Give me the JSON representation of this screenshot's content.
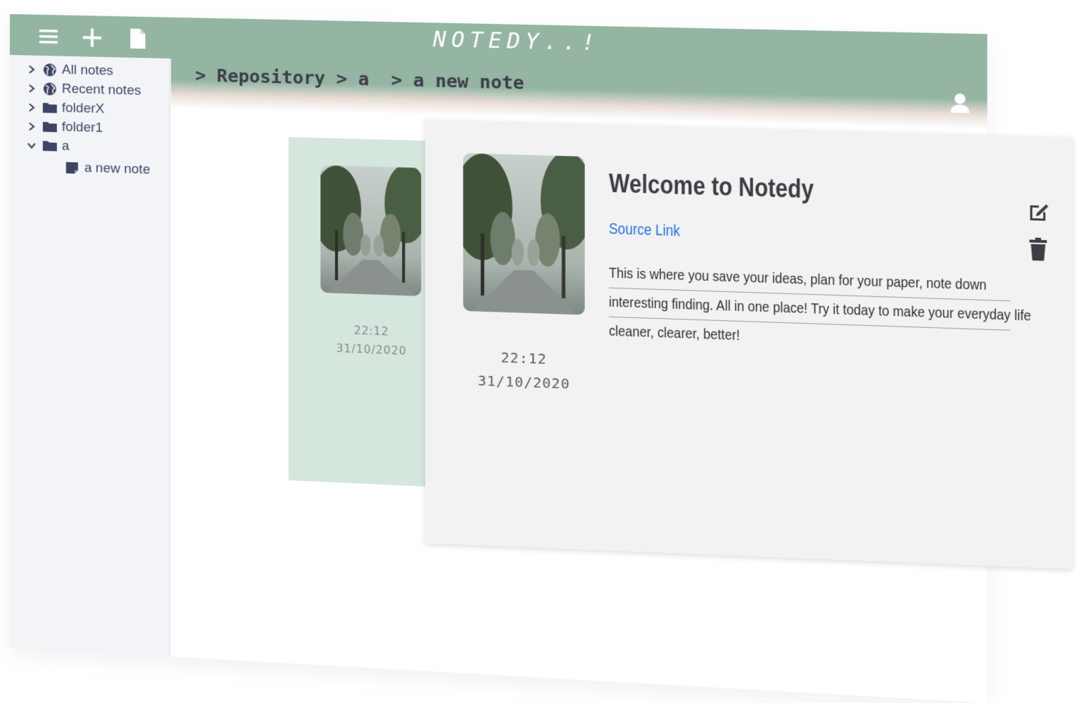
{
  "app": {
    "title": "NOTEDY..!",
    "breadcrumb": "> Repository > a  > a new note"
  },
  "toolbar": {
    "icons": [
      "menu-icon",
      "add-icon",
      "new-file-icon"
    ]
  },
  "header": {
    "user_icon": "user-icon"
  },
  "sidebar": {
    "items": [
      {
        "label": "All notes",
        "icon": "globe-icon",
        "expanded": false
      },
      {
        "label": "Recent notes",
        "icon": "globe-icon",
        "expanded": false
      },
      {
        "label": "folderX",
        "icon": "folder-icon",
        "expanded": false
      },
      {
        "label": "folder1",
        "icon": "folder-icon",
        "expanded": false
      },
      {
        "label": "a",
        "icon": "folder-icon",
        "expanded": true
      },
      {
        "label": "a new note",
        "icon": "note-icon"
      }
    ]
  },
  "background_note": {
    "time": "22:12",
    "date": "31/10/2020"
  },
  "note": {
    "title": "Welcome to Notedy",
    "source_link": "Source Link",
    "body_lines": [
      "This is where you save your ideas, plan for your paper, note down",
      "interesting finding. All in one place! Try it today to make your everyday life",
      "cleaner, clearer, better!"
    ],
    "time": "22:12",
    "date": "31/10/2020"
  },
  "colors": {
    "topbar": "#93b5a2",
    "sidebar_bg": "#f3f4f8",
    "back_card": "#d5e6dd",
    "note_card": "#f2f2f2",
    "link": "#1a73e8",
    "glow": "#46b4a0"
  }
}
